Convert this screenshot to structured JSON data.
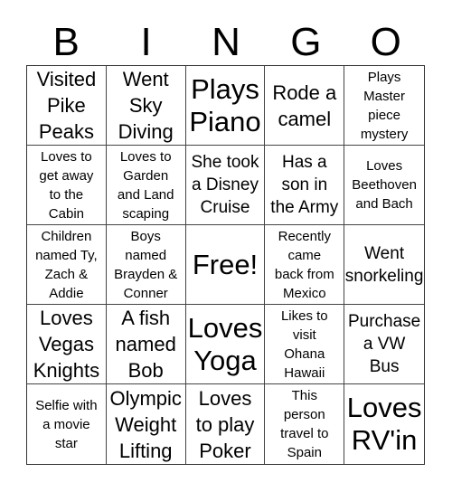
{
  "header": [
    "B",
    "I",
    "N",
    "G",
    "O"
  ],
  "cells": [
    {
      "text": "Visited\nPike\nPeaks",
      "size": "lg"
    },
    {
      "text": "Went\nSky\nDiving",
      "size": "lg"
    },
    {
      "text": "Plays\nPiano",
      "size": "xl"
    },
    {
      "text": "Rode a\ncamel",
      "size": "lg"
    },
    {
      "text": "Plays\nMaster\npiece\nmystery",
      "size": "sm"
    },
    {
      "text": "Loves to\nget away\nto the\nCabin",
      "size": "sm"
    },
    {
      "text": "Loves to\nGarden\nand Land\nscaping",
      "size": "sm"
    },
    {
      "text": "She took\na Disney\nCruise",
      "size": "md"
    },
    {
      "text": "Has a\nson in\nthe Army",
      "size": "md"
    },
    {
      "text": "Loves\nBeethoven\nand Bach",
      "size": "sm"
    },
    {
      "text": "Children\nnamed Ty,\nZach &\nAddie",
      "size": "sm"
    },
    {
      "text": "Boys\nnamed\nBrayden &\nConner",
      "size": "sm"
    },
    {
      "text": "Free!",
      "size": "xl"
    },
    {
      "text": "Recently\ncame\nback from\nMexico",
      "size": "sm"
    },
    {
      "text": "Went\nsnorkeling",
      "size": "md"
    },
    {
      "text": "Loves\nVegas\nKnights",
      "size": "lg"
    },
    {
      "text": "A fish\nnamed\nBob",
      "size": "lg"
    },
    {
      "text": "Loves\nYoga",
      "size": "xl"
    },
    {
      "text": "Likes to\nvisit\nOhana\nHawaii",
      "size": "sm"
    },
    {
      "text": "Purchase\na VW\nBus",
      "size": "md"
    },
    {
      "text": "Selfie with\na movie\nstar",
      "size": "sm"
    },
    {
      "text": "Olympic\nWeight\nLifting",
      "size": "lg"
    },
    {
      "text": "Loves\nto play\nPoker",
      "size": "lg"
    },
    {
      "text": "This\nperson\ntravel to\nSpain",
      "size": "sm"
    },
    {
      "text": "Loves\nRV'in",
      "size": "xl"
    }
  ]
}
